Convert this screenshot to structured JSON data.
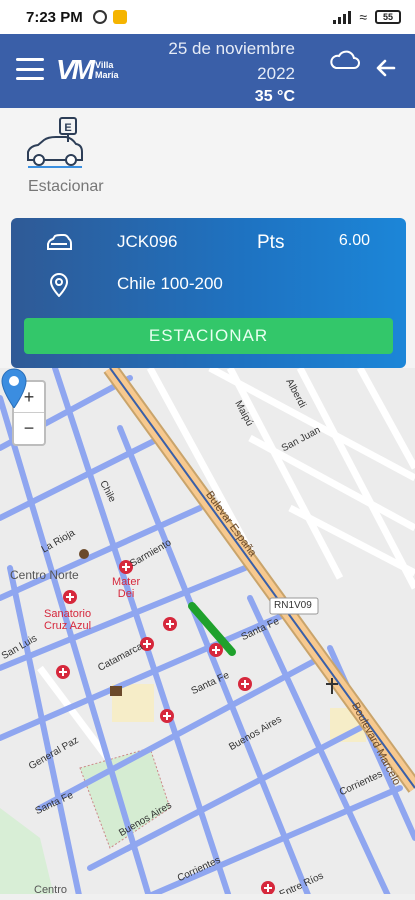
{
  "status_bar": {
    "time": "7:23 PM",
    "battery": "55"
  },
  "header": {
    "logo_text_line1": "Villa",
    "logo_text_line2": "María",
    "date_line1": "25 de noviembre",
    "date_line2": "2022",
    "temperature": "35 °C",
    "icons": {
      "menu": "hamburger-icon",
      "weather": "cloud-icon",
      "back": "arrow-left-icon"
    }
  },
  "quick_action": {
    "label": "Estacionar",
    "icon": "car-parking-icon"
  },
  "parking_card": {
    "plate": "JCK096",
    "points_label": "Pts",
    "points_value": "6.00",
    "address": "Chile 100-200",
    "button_label": "ESTACIONAR",
    "colors": {
      "gradient_start": "#2f5a96",
      "gradient_end": "#1c86d8",
      "button": "#33c76a"
    }
  },
  "map": {
    "zoom_in": "+",
    "zoom_out": "−",
    "labels": {
      "centro_norte": "Centro Norte",
      "mater_dei_1": "Mater",
      "mater_dei_2": "Dei",
      "sanatorio_1": "Sanatorio",
      "sanatorio_2": "Cruz Azul",
      "bulevar_espana": "Bulevar España",
      "boulevard_marcelo": "Boulevard Marcelo",
      "route": "RN1V09",
      "santa_fe_1": "Santa Fe",
      "santa_fe_2": "Santa Fe",
      "santa_fe_3": "Santa Fe",
      "buenos_aires_1": "Buenos Aires",
      "buenos_aires_2": "Buenos Aires",
      "catamarca": "Catamarca",
      "corrientes_1": "Corrientes",
      "corrientes_2": "Corrientes",
      "san_juan": "San Juan",
      "alberdi": "Alberdi",
      "maipu": "Maipú",
      "chile": "Chile",
      "sarmiento": "Sarmiento",
      "la_rioja": "La Rioja",
      "general_paz": "General Paz",
      "entre_rios": "Entre Ríos",
      "san_luis": "San Luis",
      "centro": "Centro"
    },
    "colors": {
      "street": "#8fa6f0",
      "avenue": "#f7c98f",
      "park": "#cfe8c9",
      "road_line": "#a9a9a9"
    }
  }
}
